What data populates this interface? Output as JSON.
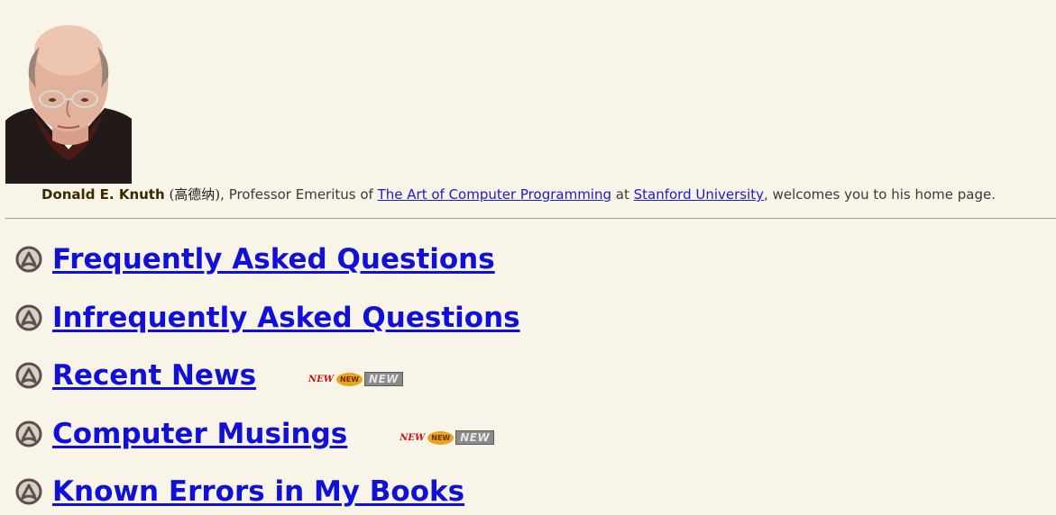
{
  "header": {
    "author_name": "Donald E. Knuth",
    "chinese_name": "(高德纳)",
    "text_professor": ", Professor Emeritus of ",
    "link_taocp": "The Art of Computer Programming",
    "text_at": " at ",
    "link_stanford": "Stanford University",
    "text_welcome": ", welcomes you to his home page."
  },
  "nav": {
    "items": [
      {
        "label": "Frequently Asked Questions",
        "is_new": false
      },
      {
        "label": "Infrequently Asked Questions",
        "is_new": false
      },
      {
        "label": "Recent News",
        "is_new": true
      },
      {
        "label": "Computer Musings",
        "is_new": true
      },
      {
        "label": "Known Errors in My Books",
        "is_new": false
      }
    ],
    "bullet_icon": "knuth-bullet-icon",
    "new_badge": {
      "red_text": "NEW",
      "oval_text": "NEW",
      "gray_text": "NEW"
    }
  },
  "colors": {
    "background": "#f8f4e8",
    "link": "#1010d8",
    "rule": "#9a9a9a"
  }
}
